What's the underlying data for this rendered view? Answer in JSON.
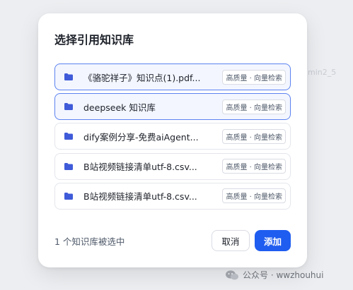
{
  "modal": {
    "title": "选择引用知识库",
    "items": [
      {
        "name": "《骆驼祥子》知识点(1).pdf...",
        "badge": "高质量 · 向量检索",
        "selected": true
      },
      {
        "name": "deepseek 知识库",
        "badge": "高质量 · 向量检索",
        "selected": true
      },
      {
        "name": "dify案例分享-免费aiAgent...",
        "badge": "高质量 · 向量检索",
        "selected": false
      },
      {
        "name": "B站视频链接清单utf-8.csv...",
        "badge": "高质量 · 向量检索",
        "selected": false
      },
      {
        "name": "B站视频链接清单utf-8.csv...",
        "badge": "高质量 · 向量检索",
        "selected": false
      }
    ],
    "status": "1 个知识库被选中",
    "cancel_label": "取消",
    "add_label": "添加"
  },
  "background": {
    "fragment": "min2_5"
  },
  "watermark": {
    "text": "公众号 · wwzhouhui"
  },
  "colors": {
    "accent": "#1f5df0",
    "selected_border": "#5b82f0",
    "folder_icon": "#3f5bd9"
  },
  "icons": {
    "item": "folder-icon",
    "watermark": "wechat-icon"
  }
}
